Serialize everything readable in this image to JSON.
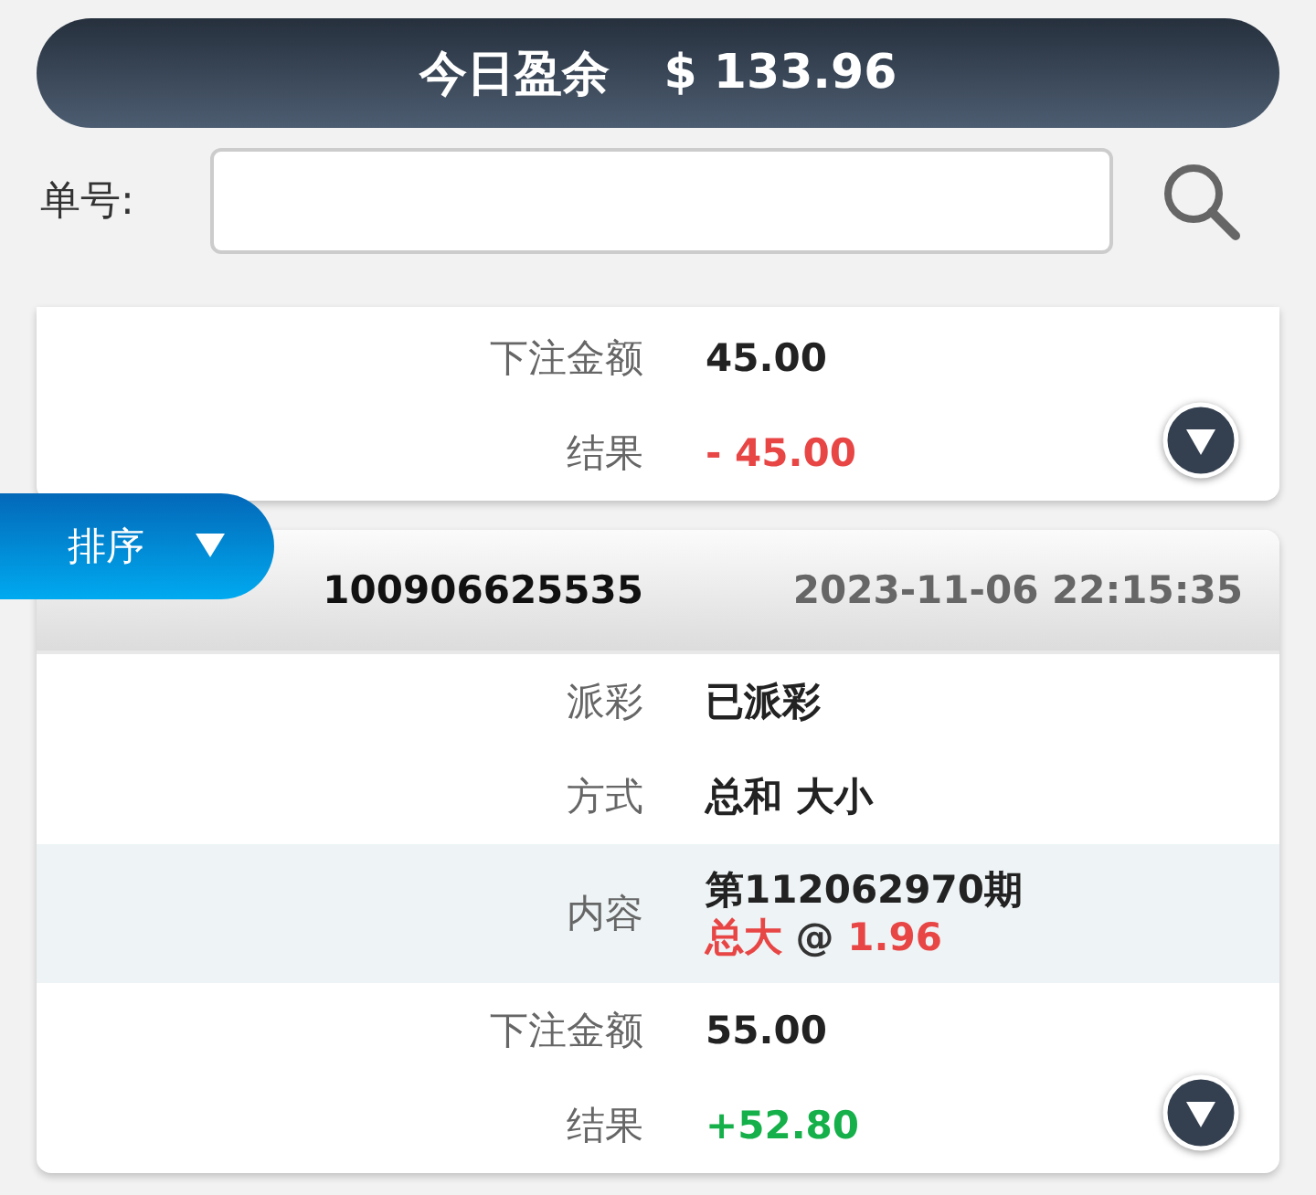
{
  "summary": {
    "label": "今日盈余",
    "amount": "$ 133.96"
  },
  "search": {
    "label": "单号:"
  },
  "sort_button": {
    "label": "排序"
  },
  "orders": [
    {
      "partial": true,
      "rows": [
        {
          "kind": "plain",
          "label": "下注金额",
          "value": "45.00"
        },
        {
          "kind": "loss",
          "label": "结果",
          "value": "- 45.00"
        }
      ]
    },
    {
      "partial": false,
      "order_no": "100906625535",
      "time": "2023-11-06 22:15:35",
      "rows": [
        {
          "kind": "plain",
          "label": "派彩",
          "value": "已派彩"
        },
        {
          "kind": "plain",
          "label": "方式",
          "value": "总和 大小"
        },
        {
          "kind": "content",
          "label": "内容",
          "period": "第112062970期",
          "pick": "总大",
          "at": "@",
          "odds": "1.96"
        },
        {
          "kind": "plain",
          "label": "下注金额",
          "value": "55.00"
        },
        {
          "kind": "win",
          "label": "结果",
          "value": "+52.80"
        }
      ]
    }
  ]
}
